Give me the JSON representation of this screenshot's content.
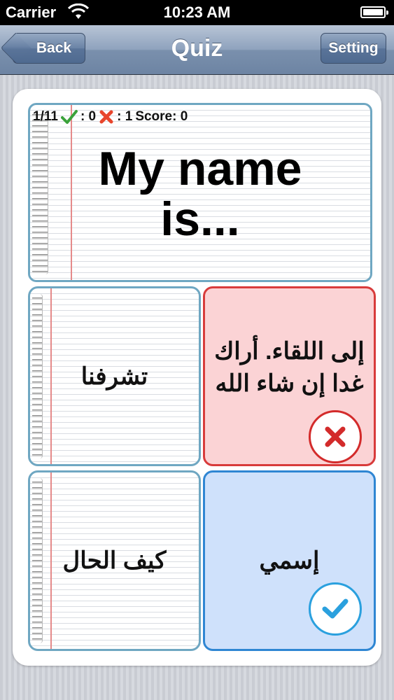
{
  "status_bar": {
    "carrier": "Carrier",
    "time": "10:23 AM"
  },
  "nav": {
    "title": "Quiz",
    "back_label": "Back",
    "setting_label": "Setting"
  },
  "quiz": {
    "progress": "1/11",
    "correct_count": ": 0",
    "wrong_count": ": 1",
    "score": "Score: 0",
    "question_line1": "My name",
    "question_line2": "is...",
    "answers": [
      {
        "text": "تشرفنا",
        "state": "neutral"
      },
      {
        "text": "إلى اللقاء. أراك غدا إن شاء الله",
        "state": "wrong"
      },
      {
        "text": "كيف الحال",
        "state": "neutral"
      },
      {
        "text": "إسمي",
        "state": "correct"
      }
    ]
  },
  "colors": {
    "wrong_border": "#d83b3b",
    "wrong_bg": "#fbd3d5",
    "correct_border": "#2f86d3",
    "correct_bg": "#cfe1fb",
    "notebook_border": "#6fa7c2"
  },
  "icons": [
    "wifi-icon",
    "battery-icon",
    "check-icon",
    "x-icon",
    "wrong-x-icon",
    "correct-check-icon"
  ]
}
